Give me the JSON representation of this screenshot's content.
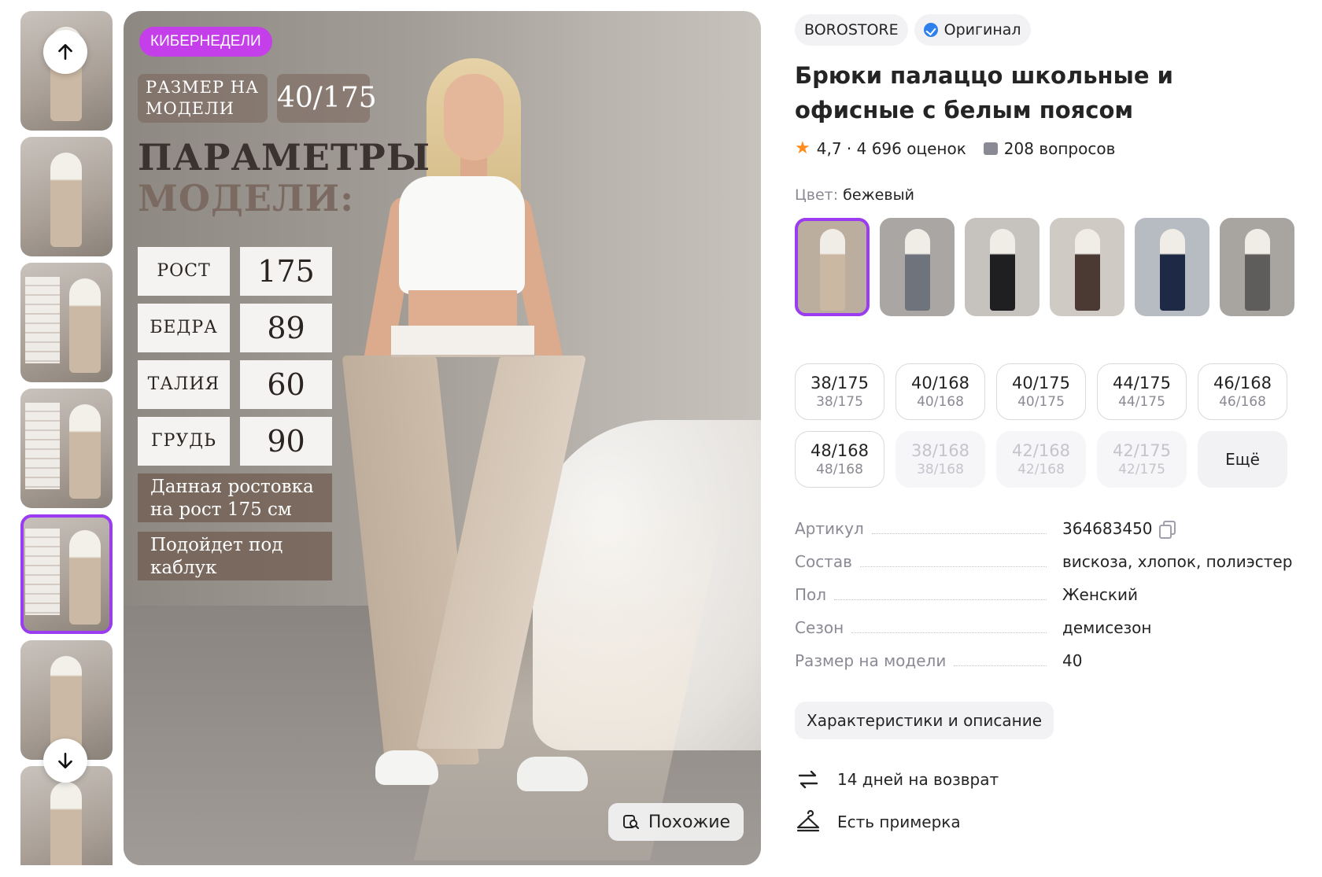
{
  "gallery": {
    "thumbnails": [
      "thumb-1",
      "thumb-2",
      "thumb-3",
      "thumb-4",
      "thumb-5",
      "thumb-6",
      "thumb-7"
    ],
    "active_index": 4
  },
  "main_image": {
    "promo_badge": "КИБЕРНЕДЕЛИ",
    "size_on_model_label": "РАЗМЕР НА МОДЕЛИ",
    "size_on_model_value": "40/175",
    "params_title_line1": "ПАРАМЕТРЫ",
    "params_title_line2": "МОДЕЛИ:",
    "params": [
      {
        "label": "РОСТ",
        "value": "175"
      },
      {
        "label": "БЕДРА",
        "value": "89"
      },
      {
        "label": "ТАЛИЯ",
        "value": "60"
      },
      {
        "label": "ГРУДЬ",
        "value": "90"
      }
    ],
    "note1": "Данная ростовка на рост 175 см",
    "note2": "Подойдет под каблук",
    "similar_button": "Похожие"
  },
  "product": {
    "brand": "BOROSTORE",
    "original_badge": "Оригинал",
    "title": "Брюки палаццо школьные и офисные с белым поясом",
    "rating": "4,7 · 4 696 оценок",
    "questions": "208 вопросов",
    "color_label": "Цвет:",
    "color_value": "бежевый",
    "color_variants": [
      {
        "name": "beige",
        "bg": "#bcae9f",
        "fig": "#cbb8a3"
      },
      {
        "name": "gray",
        "bg": "#a9a6a3",
        "fig": "#6f747c"
      },
      {
        "name": "black",
        "bg": "#c6c2bd",
        "fig": "#1f1f22"
      },
      {
        "name": "brown",
        "bg": "#cfcac4",
        "fig": "#4a3a33"
      },
      {
        "name": "navy",
        "bg": "#b7bcc2",
        "fig": "#1e2a45"
      },
      {
        "name": "dark-gray",
        "bg": "#a8a4a0",
        "fig": "#5e5d5b"
      }
    ],
    "sizes": [
      {
        "main": "38/175",
        "sub": "38/175",
        "state": "available"
      },
      {
        "main": "40/168",
        "sub": "40/168",
        "state": "available"
      },
      {
        "main": "40/175",
        "sub": "40/175",
        "state": "available"
      },
      {
        "main": "44/175",
        "sub": "44/175",
        "state": "available"
      },
      {
        "main": "46/168",
        "sub": "46/168",
        "state": "available"
      },
      {
        "main": "48/168",
        "sub": "48/168",
        "state": "available"
      },
      {
        "main": "38/168",
        "sub": "38/168",
        "state": "disabled"
      },
      {
        "main": "42/168",
        "sub": "42/168",
        "state": "disabled"
      },
      {
        "main": "42/175",
        "sub": "42/175",
        "state": "disabled"
      }
    ],
    "more_sizes": "Ещё",
    "specs": [
      {
        "key": "Артикул",
        "value": "364683450"
      },
      {
        "key": "Состав",
        "value": "вискоза, хлопок, полиэстер"
      },
      {
        "key": "Пол",
        "value": "Женский"
      },
      {
        "key": "Сезон",
        "value": "демисезон"
      },
      {
        "key": "Размер на модели",
        "value": "40"
      }
    ],
    "characteristics_button": "Характеристики и описание",
    "return_text": "14 дней на возврат",
    "fitting_text": "Есть примерка"
  },
  "colors": {
    "accent": "#9b3cf2",
    "promo": "#c43fe9",
    "verified": "#2f80ed",
    "star": "#ff8c1a"
  }
}
